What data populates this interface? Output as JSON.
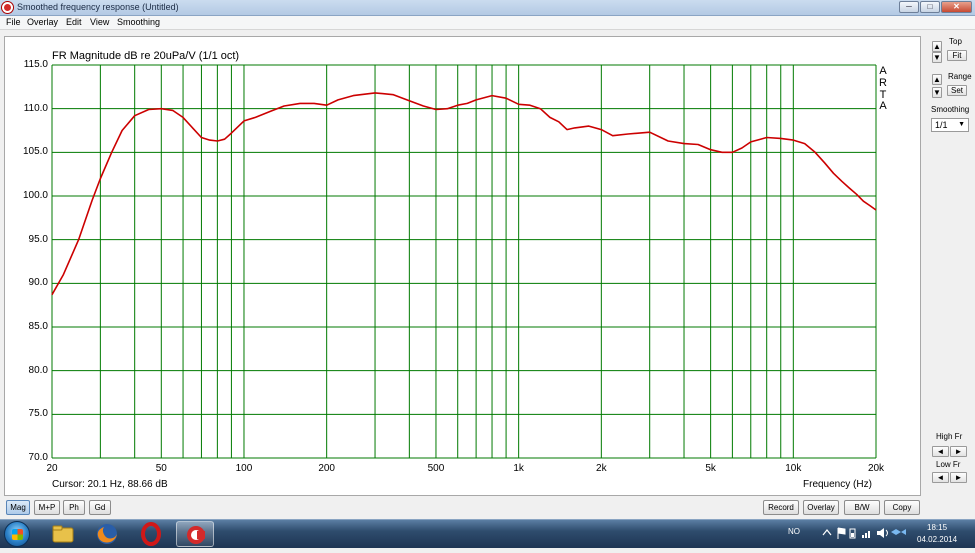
{
  "window": {
    "title": "Smoothed frequency response (Untitled)",
    "minimize": "─",
    "maximize": "□",
    "close": "✕"
  },
  "menu": [
    "File",
    "Overlay",
    "Edit",
    "View",
    "Smoothing"
  ],
  "plot": {
    "title": "FR Magnitude dB re 20uPa/V (1/1 oct)",
    "watermark": [
      "A",
      "R",
      "T",
      "A"
    ],
    "cursor_text": "Cursor: 20.1 Hz, 88.66 dB",
    "xlabel": "Frequency (Hz)"
  },
  "chart_data": {
    "type": "line",
    "title": "FR Magnitude dB re 20uPa/V (1/1 oct)",
    "xlabel": "Frequency (Hz)",
    "ylabel": "",
    "xscale": "log",
    "xlim": [
      20,
      20000
    ],
    "ylim": [
      70,
      115
    ],
    "grid": true,
    "y_ticks": [
      "115.0",
      "110.0",
      "105.0",
      "100.0",
      "95.0",
      "90.0",
      "85.0",
      "80.0",
      "75.0",
      "70.0"
    ],
    "x_ticks": [
      {
        "value": 20,
        "label": "20"
      },
      {
        "value": 50,
        "label": "50"
      },
      {
        "value": 100,
        "label": "100"
      },
      {
        "value": 200,
        "label": "200"
      },
      {
        "value": 500,
        "label": "500"
      },
      {
        "value": 1000,
        "label": "1k"
      },
      {
        "value": 2000,
        "label": "2k"
      },
      {
        "value": 5000,
        "label": "5k"
      },
      {
        "value": 10000,
        "label": "10k"
      },
      {
        "value": 20000,
        "label": "20k"
      }
    ],
    "series": [
      {
        "color": "#cc0000",
        "x": [
          20,
          22,
          25,
          28,
          30,
          33,
          36,
          40,
          45,
          50,
          55,
          60,
          65,
          70,
          75,
          80,
          85,
          90,
          100,
          110,
          125,
          140,
          160,
          180,
          200,
          220,
          250,
          300,
          350,
          400,
          450,
          500,
          550,
          600,
          650,
          700,
          800,
          900,
          1000,
          1100,
          1200,
          1300,
          1400,
          1500,
          1600,
          1800,
          2000,
          2200,
          2500,
          3000,
          3500,
          4000,
          4500,
          5000,
          5500,
          6000,
          6500,
          7000,
          8000,
          9000,
          10000,
          11000,
          12000,
          13000,
          14000,
          15000,
          16000,
          17000,
          18000,
          19000,
          20000
        ],
        "y": [
          88.7,
          91.0,
          95.0,
          99.5,
          102.0,
          105.0,
          107.5,
          109.2,
          109.9,
          110.0,
          109.8,
          109.0,
          107.8,
          106.7,
          106.4,
          106.3,
          106.5,
          107.2,
          108.6,
          109.0,
          109.7,
          110.3,
          110.6,
          110.6,
          110.4,
          111.0,
          111.5,
          111.8,
          111.6,
          110.9,
          110.3,
          109.9,
          110.0,
          110.4,
          110.6,
          111.0,
          111.5,
          111.2,
          110.5,
          110.4,
          110.0,
          109.0,
          108.5,
          107.6,
          107.8,
          108.0,
          107.6,
          106.9,
          107.1,
          107.3,
          106.3,
          106.0,
          105.9,
          105.3,
          105.0,
          105.0,
          105.5,
          106.2,
          106.7,
          106.6,
          106.4,
          106.0,
          105.0,
          103.8,
          102.6,
          101.7,
          100.9,
          100.2,
          99.4,
          98.9,
          98.4
        ]
      }
    ]
  },
  "right_panel": {
    "top_label": "Top",
    "fit_label": "Fit",
    "range_label": "Range",
    "set_label": "Set",
    "smoothing_label": "Smoothing",
    "smoothing_value": "1/1",
    "high_fr_label": "High Fr",
    "low_fr_label": "Low Fr",
    "up_arrow": "▲",
    "down_arrow": "▼",
    "left_arrow": "◄",
    "right_arrow": "►"
  },
  "bottom_buttons": {
    "left": [
      "Mag",
      "M+P",
      "Ph",
      "Gd"
    ],
    "right": [
      "Record",
      "Overlay",
      "B/W",
      "Copy"
    ],
    "active": "Mag"
  },
  "taskbar": {
    "lang": "NO",
    "time": "18:15",
    "date": "04.02.2014"
  },
  "colors": {
    "grid": "#007a00",
    "curve": "#cc0000",
    "plot_bg": "#ffffff"
  }
}
